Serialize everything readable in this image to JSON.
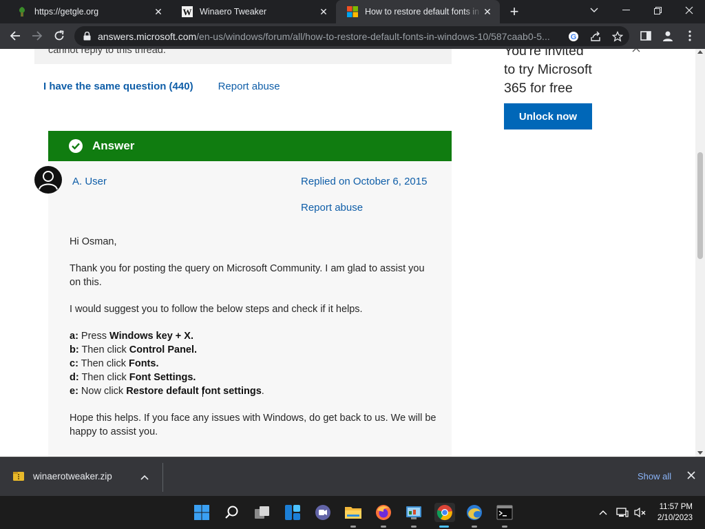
{
  "browser": {
    "tabs": [
      {
        "title": "https://getgle.org",
        "icon": "tree-favicon",
        "active": false
      },
      {
        "title": "Winaero Tweaker",
        "icon": "winaero-w-favicon",
        "active": false
      },
      {
        "title": "How to restore default fonts in W",
        "icon": "microsoft-favicon",
        "active": true
      }
    ],
    "url_host": "answers.microsoft.com",
    "url_path": "/en-us/windows/forum/all/how-to-restore-default-fonts-in-windows-10/587caab0-5..."
  },
  "page": {
    "locked_notice": "cannot reply to this thread.",
    "same_question_label": "I have the same question (440)",
    "report_abuse_label": "Report abuse",
    "answer_header": "Answer",
    "answer": {
      "author": "A. User",
      "replied": "Replied on October 6, 2015",
      "report_abuse": "Report abuse",
      "greeting": "Hi Osman,",
      "para1": "Thank you for posting the query on Microsoft Community. I am glad to assist you on this.",
      "para2": "I would suggest you to follow the below steps and check if it helps.",
      "steps": [
        {
          "key": "a:",
          "text": " Press ",
          "bold": "Windows key + X.",
          "tail": ""
        },
        {
          "key": "b:",
          "text": " Then click ",
          "bold": "Control Panel.",
          "tail": ""
        },
        {
          "key": "c:",
          "text": " Then click ",
          "bold": "Fonts.",
          "tail": ""
        },
        {
          "key": "d:",
          "text": " Then click ",
          "bold": "Font Settings.",
          "tail": ""
        },
        {
          "key": "e:",
          "text": " Now click ",
          "bold": "Restore default font settings",
          "tail": "."
        }
      ],
      "closing": "Hope this helps. If you face any issues with Windows, do get back to us. We will be happy to assist you."
    },
    "promo": {
      "line1": "You're invited",
      "line2": "to try Microsoft",
      "line3": "365 for free",
      "button": "Unlock now"
    }
  },
  "downloads": {
    "file": "winaerotweaker.zip",
    "show_all": "Show all"
  },
  "taskbar": {
    "time": "11:57 PM",
    "date": "2/10/2023",
    "pinned": [
      "windows-start-icon",
      "search-icon",
      "task-view-icon",
      "widgets-icon",
      "teams-chat-icon",
      "file-explorer-icon",
      "firefox-icon",
      "control-panel-icon",
      "chrome-icon",
      "edge-beta-icon",
      "terminal-icon"
    ]
  },
  "colors": {
    "answer_green": "#107c10",
    "link_blue": "#0f5ea8",
    "cta_blue": "#0067b8"
  }
}
